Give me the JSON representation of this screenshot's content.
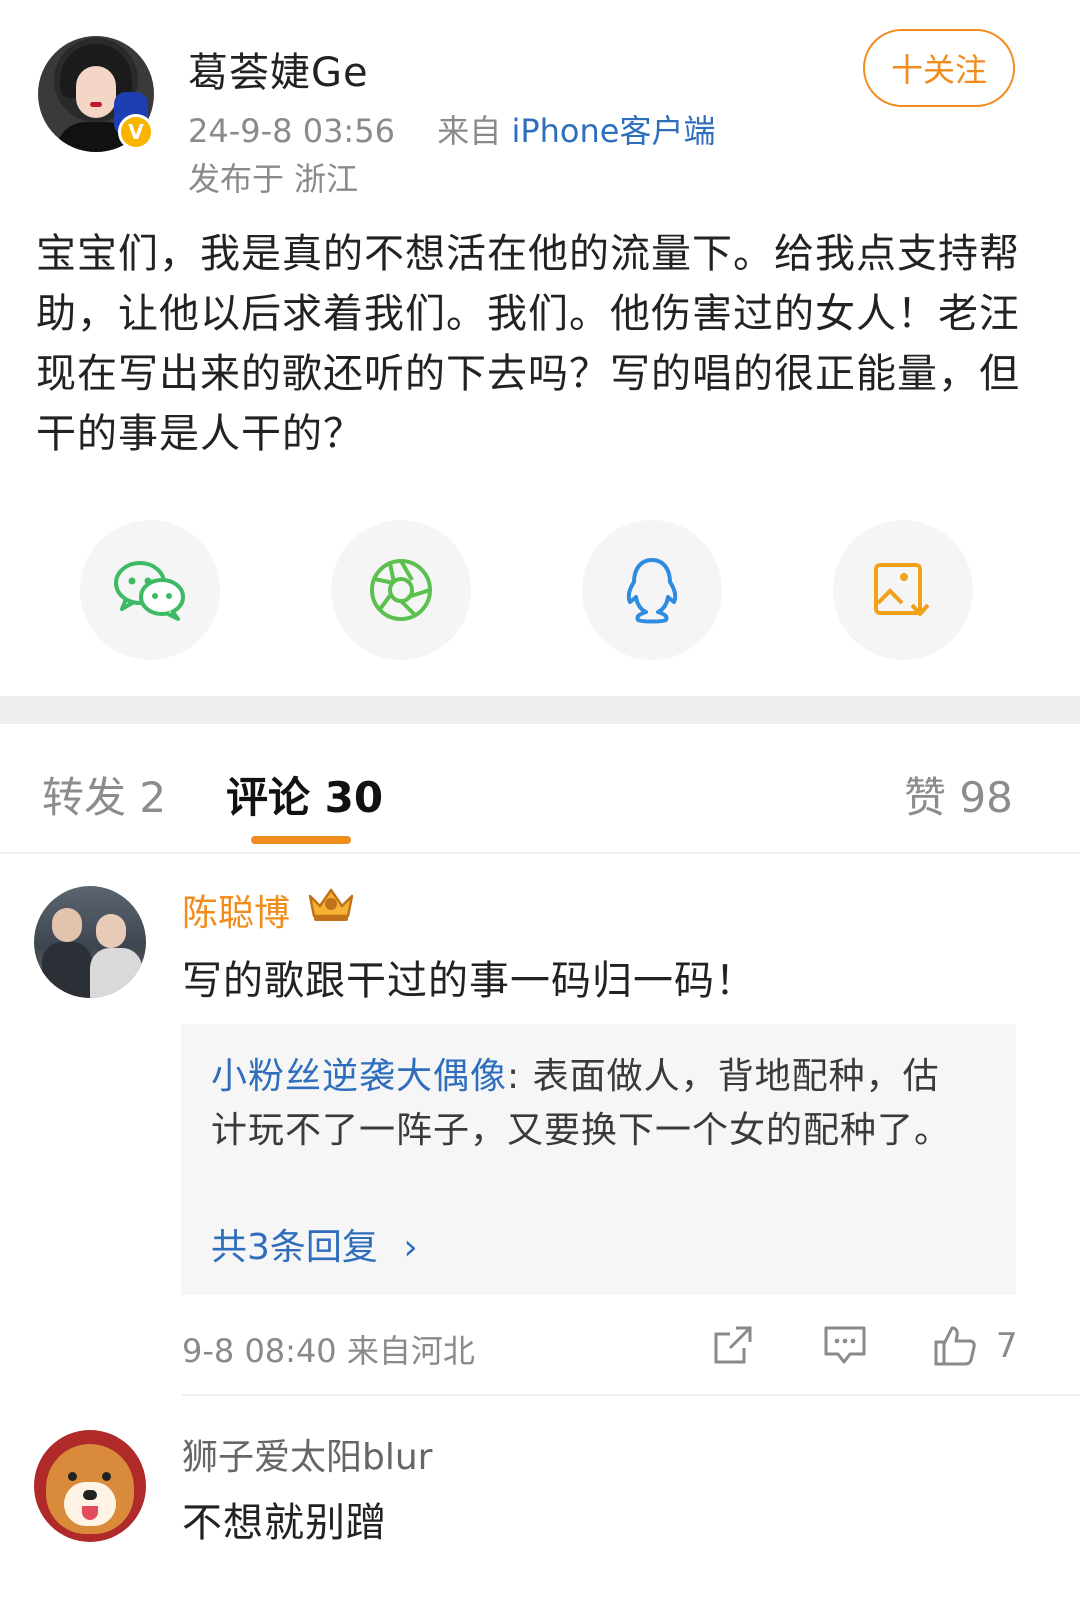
{
  "post": {
    "author": "葛荟婕Ge",
    "follow_label": "十关注",
    "date": "24-9-8 03:56",
    "source_prefix": "来自",
    "source": "iPhone客户端",
    "location": "发布于 浙江",
    "body": "宝宝们，我是真的不想活在他的流量下。给我点支持帮助，让他以后求着我们。我们。他伤害过的女人！老汪现在写出来的歌还听的下去吗？写的唱的很正能量，但干的事是人干的？"
  },
  "share": [
    {
      "icon": "wechat-icon",
      "color": "#3dbb64"
    },
    {
      "icon": "moments-icon",
      "color": "#5cc04f"
    },
    {
      "icon": "qq-icon",
      "color": "#2d8ce0"
    },
    {
      "icon": "save-image-icon",
      "color": "#f2a219"
    }
  ],
  "tabs": {
    "repost": "转发 2",
    "comments": "评论 30",
    "likes": "赞 98"
  },
  "comments": [
    {
      "name": "陈聪博",
      "text": "写的歌跟干过的事一码归一码！",
      "reply_name": "小粉丝逆袭大偶像",
      "reply_text": ": 表面做人，背地配种，估计玩不了一阵子，又要换下一个女的配种了。",
      "reply_more": "共3条回复",
      "meta": "9-8 08:40 来自河北",
      "like_count": "7"
    },
    {
      "name": "狮子爱太阳blur",
      "text": "不想就别蹭"
    }
  ],
  "colors": {
    "accent": "#f08c1b",
    "link": "#2f6ebd",
    "muted": "#8a8a8a"
  }
}
